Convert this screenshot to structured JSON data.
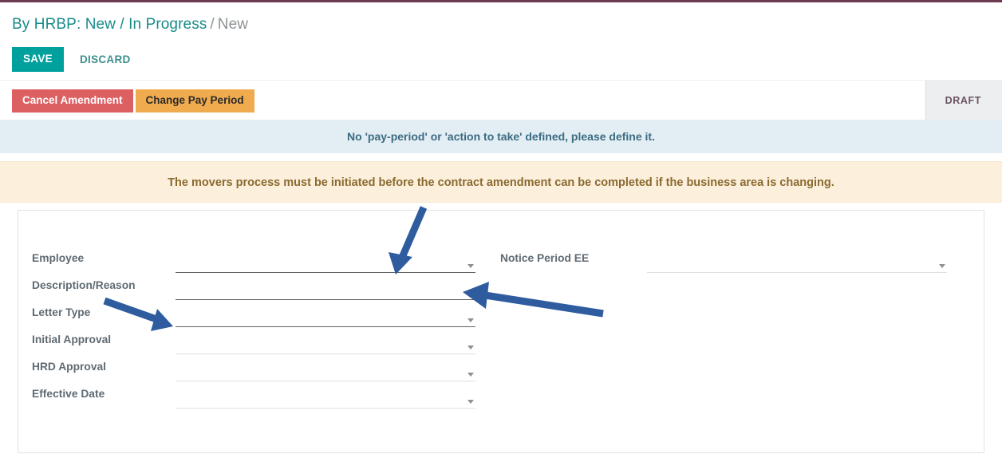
{
  "theme": {
    "accent_teal": "#00a09d",
    "top_rule": "#6c3b52",
    "danger": "#dc5f62",
    "warning_btn": "#f0ab4e",
    "alert_info_bg": "#e2eef4",
    "alert_warning_bg": "#fcefdc",
    "annotation_arrow": "#2e5c9e"
  },
  "breadcrumb": {
    "root": "By HRBP: New / In Progress",
    "separator": "/",
    "current": "New"
  },
  "actions": {
    "save_label": "SAVE",
    "discard_label": "DISCARD"
  },
  "statusbar": {
    "buttons": [
      {
        "label": "Cancel Amendment",
        "style": "danger"
      },
      {
        "label": "Change Pay Period",
        "style": "warning"
      }
    ],
    "stages": [
      {
        "label": "DRAFT",
        "active": true
      }
    ]
  },
  "alerts": [
    {
      "type": "info",
      "text": "No 'pay-period' or 'action to take' defined, please define it."
    },
    {
      "type": "warning",
      "text": "The movers process must be initiated before the contract amendment can be completed if the business area is changing."
    }
  ],
  "form": {
    "left_fields": [
      {
        "label": "Employee",
        "value": "",
        "placeholder": "",
        "underline": "strong",
        "caret": "chevron-down-icon"
      },
      {
        "label": "Description/Reason",
        "value": "",
        "placeholder": "",
        "underline": "strong",
        "caret": "chevron-down-icon"
      },
      {
        "label": "Letter Type",
        "value": "",
        "placeholder": "",
        "underline": "strong",
        "caret": "chevron-down-icon"
      },
      {
        "label": "Initial Approval",
        "value": "",
        "placeholder": "",
        "underline": "weak",
        "caret": "chevron-down-icon"
      },
      {
        "label": "HRD Approval",
        "value": "",
        "placeholder": "",
        "underline": "weak",
        "caret": "chevron-down-icon"
      },
      {
        "label": "Effective Date",
        "value": "",
        "placeholder": "",
        "underline": "weak",
        "caret": "chevron-down-icon"
      }
    ],
    "right_fields": [
      {
        "label": "Notice Period EE",
        "value": "",
        "placeholder": "",
        "underline": "weak",
        "caret": "chevron-down-icon"
      }
    ]
  },
  "annotations": [
    {
      "name": "arrow-to-employee-field",
      "direction": "down-left"
    },
    {
      "name": "arrow-to-description-reason-field",
      "direction": "left"
    },
    {
      "name": "arrow-to-letter-type-field",
      "direction": "down-right"
    }
  ]
}
